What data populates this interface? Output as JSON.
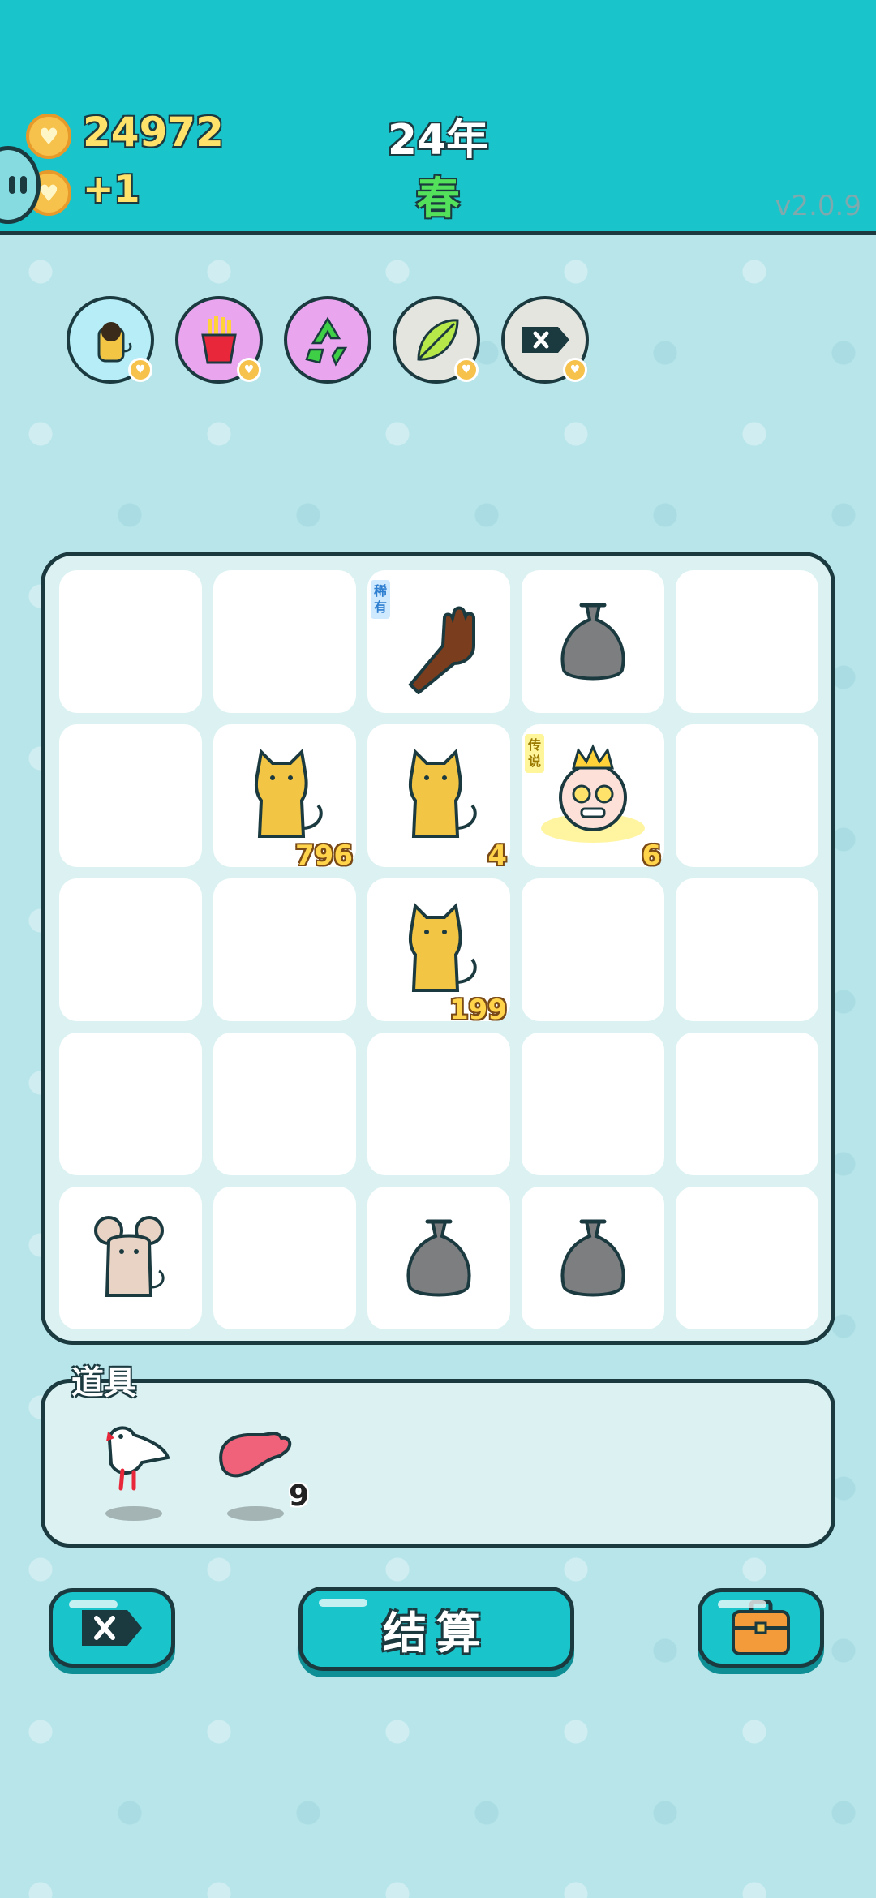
{
  "header": {
    "coins": "24972",
    "coin_gain": "+1",
    "year": "24年",
    "season": "春",
    "version": "v2.0.9"
  },
  "buffs": [
    {
      "icon": "cat-buff-icon",
      "bg": "#b7edf6"
    },
    {
      "icon": "fries-buff-icon",
      "bg": "#e9a6ee"
    },
    {
      "icon": "recycle-buff-icon",
      "bg": "#e9a6ee"
    },
    {
      "icon": "leaf-buff-icon",
      "bg": "#e5e5e0"
    },
    {
      "icon": "delete-tag-buff-icon",
      "bg": "#e5e5e0"
    }
  ],
  "board": {
    "rows": [
      [
        {
          "item": ""
        },
        {
          "item": ""
        },
        {
          "item": "hand-icon",
          "tag": "稀有"
        },
        {
          "item": "trash-bag-icon"
        },
        {
          "item": ""
        }
      ],
      [
        {
          "item": ""
        },
        {
          "item": "cat-icon",
          "count": "796"
        },
        {
          "item": "cat-icon",
          "count": "4"
        },
        {
          "item": "king-icon",
          "tag": "传说",
          "count": "6"
        },
        {
          "item": ""
        }
      ],
      [
        {
          "item": ""
        },
        {
          "item": ""
        },
        {
          "item": "cat-icon",
          "count": "199"
        },
        {
          "item": ""
        },
        {
          "item": ""
        }
      ],
      [
        {
          "item": ""
        },
        {
          "item": ""
        },
        {
          "item": ""
        },
        {
          "item": ""
        },
        {
          "item": ""
        }
      ],
      [
        {
          "item": "mouse-icon"
        },
        {
          "item": ""
        },
        {
          "item": "trash-bag-icon"
        },
        {
          "item": "trash-bag-icon"
        },
        {
          "item": ""
        }
      ]
    ]
  },
  "items": {
    "label": "道具",
    "list": [
      {
        "icon": "bird-icon",
        "count": ""
      },
      {
        "icon": "meat-icon",
        "count": "9"
      }
    ]
  },
  "buttons": {
    "settle_label": "结算"
  },
  "colors": {
    "header_bg": "#19c4cb",
    "page_bg": "#b7e5ea",
    "outline": "#1b3a40",
    "coin_text": "#ffe26a",
    "season_text": "#53e05b"
  }
}
